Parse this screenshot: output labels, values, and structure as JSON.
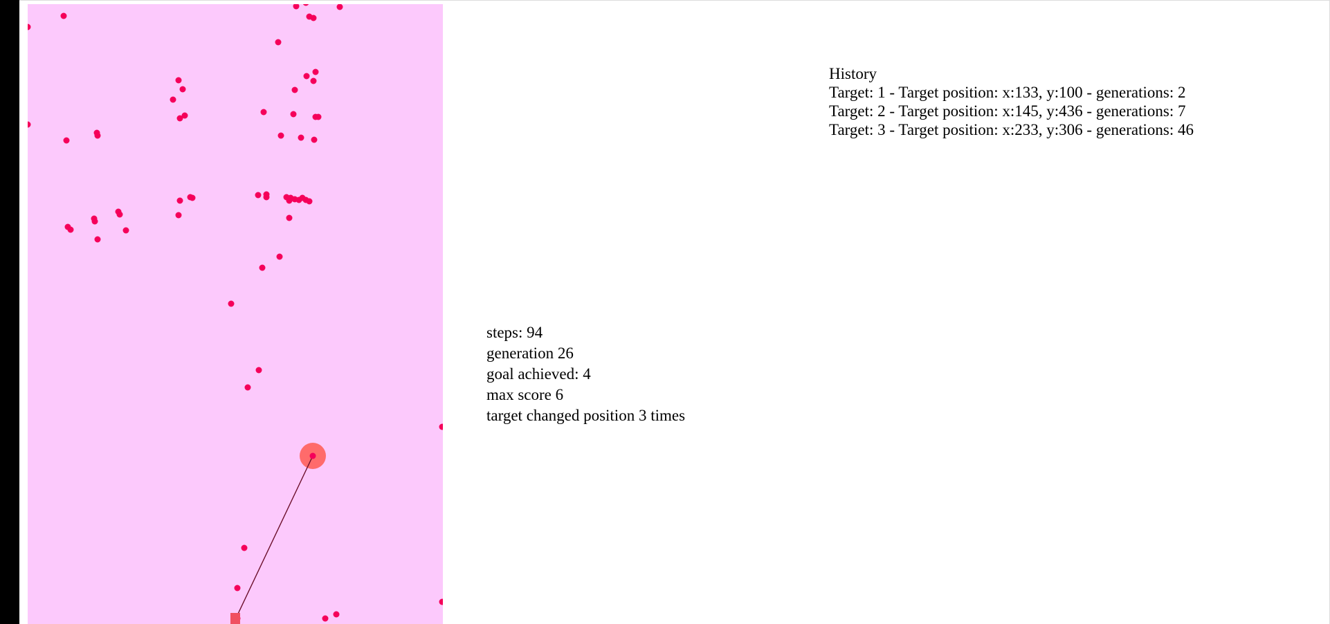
{
  "colors": {
    "canvas_background": "#fcc9fc",
    "dot": "#f5005a",
    "target": "#ff6b6b",
    "target_center": "#f5005a",
    "line": "#6b0f2a",
    "start_square": "#f05060"
  },
  "stats": {
    "steps": "steps: 94",
    "generation": "generation 26",
    "goal_achieved": "goal achieved: 4",
    "max_score": "max score 6",
    "target_changes": "target changed position 3 times"
  },
  "history": {
    "title": "History",
    "entries": [
      "Target: 1 - Target position: x:133, y:100 - generations: 2",
      "Target: 2 - Target position: x:145, y:436 - generations: 7",
      "Target: 3 - Target position: x:233, y:306 - generations: 46"
    ]
  }
}
